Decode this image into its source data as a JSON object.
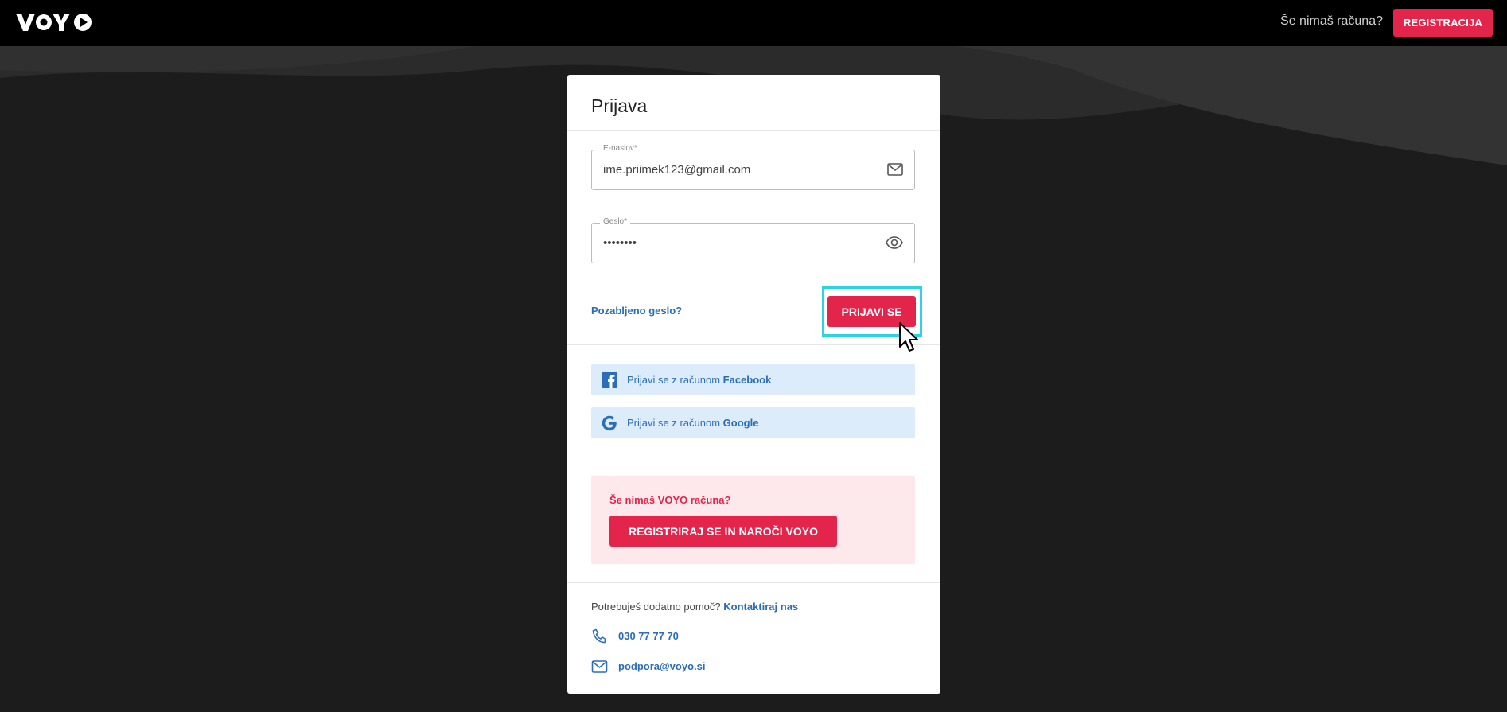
{
  "header": {
    "logo_text": "VOYO",
    "no_account_text": "Še nimaš računa?",
    "register_button": "REGISTRACIJA"
  },
  "login": {
    "title": "Prijava",
    "email": {
      "label": "E-naslov*",
      "value": "ime.priimek123@gmail.com"
    },
    "password": {
      "label": "Geslo*",
      "value": "••••••••"
    },
    "forgot_password": "Pozabljeno geslo?",
    "submit_button": "PRIJAVI SE"
  },
  "social": {
    "facebook": {
      "prefix": "Prijavi se z računom",
      "provider": "Facebook"
    },
    "google": {
      "prefix": "Prijavi se z računom",
      "provider": "Google"
    }
  },
  "promo": {
    "title": "Še nimaš VOYO računa?",
    "button": "REGISTRIRAJ SE IN NAROČI VOYO"
  },
  "help": {
    "text": "Potrebuješ dodatno pomoč?",
    "link": "Kontaktiraj nas",
    "phone": "030 77 77 70",
    "email": "podpora@voyo.si"
  },
  "colors": {
    "accent": "#e4254b",
    "link": "#2a6db8",
    "highlight": "#2cd3e6"
  }
}
